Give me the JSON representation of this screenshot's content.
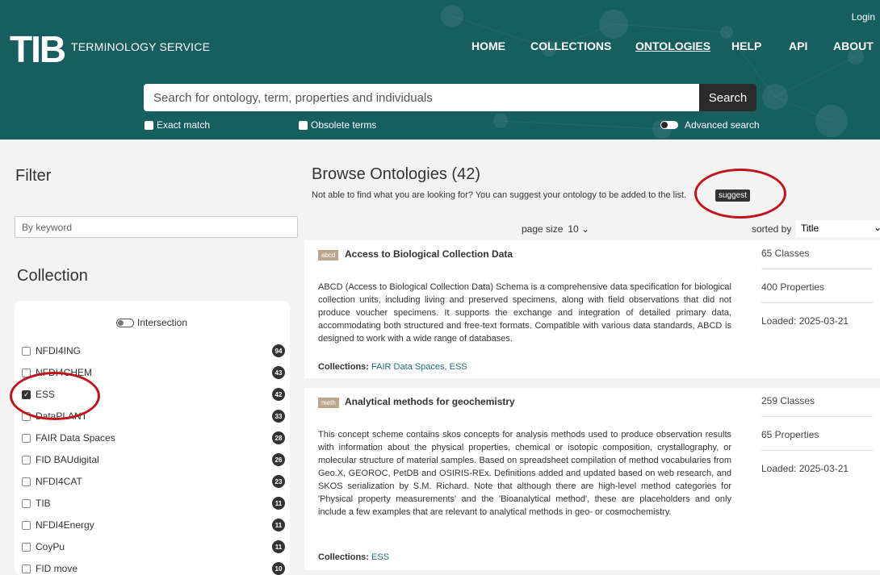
{
  "header": {
    "logo": "TIB",
    "logo_sub": "TERMINOLOGY SERVICE",
    "login": "Login",
    "nav": [
      {
        "label": "HOME",
        "active": false
      },
      {
        "label": "COLLECTIONS",
        "active": false
      },
      {
        "label": "ONTOLOGIES",
        "active": true
      },
      {
        "label": "HELP",
        "active": false
      },
      {
        "label": "API",
        "active": false
      },
      {
        "label": "ABOUT",
        "active": false
      }
    ],
    "search_placeholder": "Search for ontology, term, properties and individuals",
    "search_button": "Search",
    "exact_match": "Exact match",
    "obsolete_terms": "Obsolete terms",
    "advanced_search": "Advanced search"
  },
  "filter": {
    "title": "Filter",
    "keyword_placeholder": "By keyword",
    "collection_title": "Collection",
    "intersection_label": "Intersection",
    "collections": [
      {
        "name": "NFDI4ING",
        "count": "94",
        "checked": false
      },
      {
        "name": "NFDI4CHEM",
        "count": "43",
        "checked": false
      },
      {
        "name": "ESS",
        "count": "42",
        "checked": true
      },
      {
        "name": "DataPLANT",
        "count": "33",
        "checked": false
      },
      {
        "name": "FAIR Data Spaces",
        "count": "28",
        "checked": false
      },
      {
        "name": "FID BAUdigital",
        "count": "26",
        "checked": false
      },
      {
        "name": "NFDI4CAT",
        "count": "23",
        "checked": false
      },
      {
        "name": "TIB",
        "count": "11",
        "checked": false
      },
      {
        "name": "NFDI4Energy",
        "count": "11",
        "checked": false
      },
      {
        "name": "CoyPu",
        "count": "11",
        "checked": false
      },
      {
        "name": "FID move",
        "count": "10",
        "checked": false
      }
    ]
  },
  "main": {
    "title": "Browse Ontologies (42)",
    "subtitle": "Not able to find what you are looking for? You can suggest your ontology to be added to the list.",
    "suggest_label": "suggest",
    "page_size_label": "page size",
    "page_size_value": "10 ⌄",
    "sorted_by_label": "sorted by",
    "sorted_by_value": "Title",
    "ontologies": [
      {
        "tag": "abcd",
        "title": "Access to Biological Collection Data",
        "description": "ABCD (Access to Biological Collection Data) Schema is a comprehensive data specification for biological collection units, including living and preserved specimens, along with field observations that did not produce voucher specimens. It supports the exchange and integration of detailed primary data, accommodating both structured and free-text formats. Compatible with various data standards, ABCD is designed to work with a wide range of databases.",
        "collections_label": "Collections:",
        "collections": "FAIR Data Spaces, ESS",
        "classes": "65 Classes",
        "properties": "400 Properties",
        "loaded": "Loaded: 2025-03-21"
      },
      {
        "tag": "meth",
        "title": "Analytical methods for geochemistry",
        "description": "This concept scheme contains skos concepts for analysis methods used to produce observation results with information about the physical properties, chemical or isotopic composition, crystallography, or molecular structure of material samples. Based on spreadsheet compilation of method vocabularies from Geo.X, GEOROC, PetDB and OSIRIS-REx. Definitions added and updated based on web research, and SKOS serialization by S.M. Richard. Note that although there are high-level method categories for 'Physical property measurements' and the 'Bioanalytical method', these are placeholders and only include a few examples that are relevant to analytical methods in geo- or cosmochemistry.",
        "collections_label": "Collections:",
        "collections": "ESS",
        "classes": "259 Classes",
        "properties": "65 Properties",
        "loaded": "Loaded: 2025-03-21"
      }
    ]
  },
  "colors": {
    "header_bg": "#175e5e",
    "annotation_red": "#c0141a",
    "link": "#1f6f78"
  }
}
